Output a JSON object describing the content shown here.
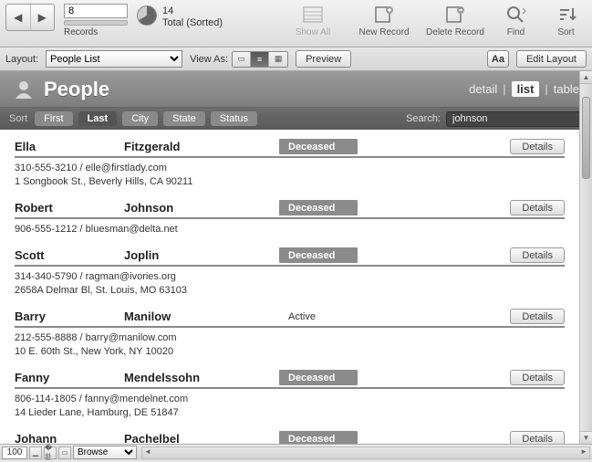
{
  "toolbar": {
    "record_number": "8",
    "records_label": "Records",
    "total_count": "14",
    "total_suffix": "Total (Sorted)",
    "show_all": "Show All",
    "new_record": "New Record",
    "delete_record": "Delete Record",
    "find": "Find",
    "sort": "Sort"
  },
  "layoutbar": {
    "layout_label": "Layout:",
    "layout_value": "People List",
    "view_as_label": "View As:",
    "preview": "Preview",
    "aa": "Aa",
    "edit_layout": "Edit Layout"
  },
  "header": {
    "title": "People",
    "detail": "detail",
    "list": "list",
    "table": "table"
  },
  "sortbar": {
    "sort_label": "Sort",
    "first": "First",
    "last": "Last",
    "city": "City",
    "state": "State",
    "status": "Status",
    "search_label": "Search:",
    "search_value": "johnson"
  },
  "details_label": "Details",
  "rows": [
    {
      "first": "Ella",
      "last": "Fitzgerald",
      "status": "Deceased",
      "status_style": "pill",
      "line1": "310-555-3210 / elle@firstlady.com",
      "line2": "1 Songbook St., Beverly Hills, CA 90211"
    },
    {
      "first": "Robert",
      "last": "Johnson",
      "status": "Deceased",
      "status_style": "pill",
      "line1": "906-555-1212 / bluesman@delta.net",
      "line2": ""
    },
    {
      "first": "Scott",
      "last": "Joplin",
      "status": "Deceased",
      "status_style": "pill",
      "line1": "314-340-5790 / ragman@ivories.org",
      "line2": "2658A Delmar Bl, St. Louis, MO 63103"
    },
    {
      "first": "Barry",
      "last": "Manilow",
      "status": "Active",
      "status_style": "plain",
      "line1": "212-555-8888 / barry@manilow.com",
      "line2": "10 E. 60th St., New York, NY 10020"
    },
    {
      "first": "Fanny",
      "last": "Mendelssohn",
      "status": "Deceased",
      "status_style": "pill",
      "line1": "806-114-1805 / fanny@mendelnet.com",
      "line2": "14 Lieder Lane, Hamburg, DE 51847"
    },
    {
      "first": "Johann",
      "last": "Pachelbel",
      "status": "Deceased",
      "status_style": "pill",
      "line1": "",
      "line2": ""
    }
  ],
  "statusbar": {
    "zoom": "100",
    "mode": "Browse"
  }
}
